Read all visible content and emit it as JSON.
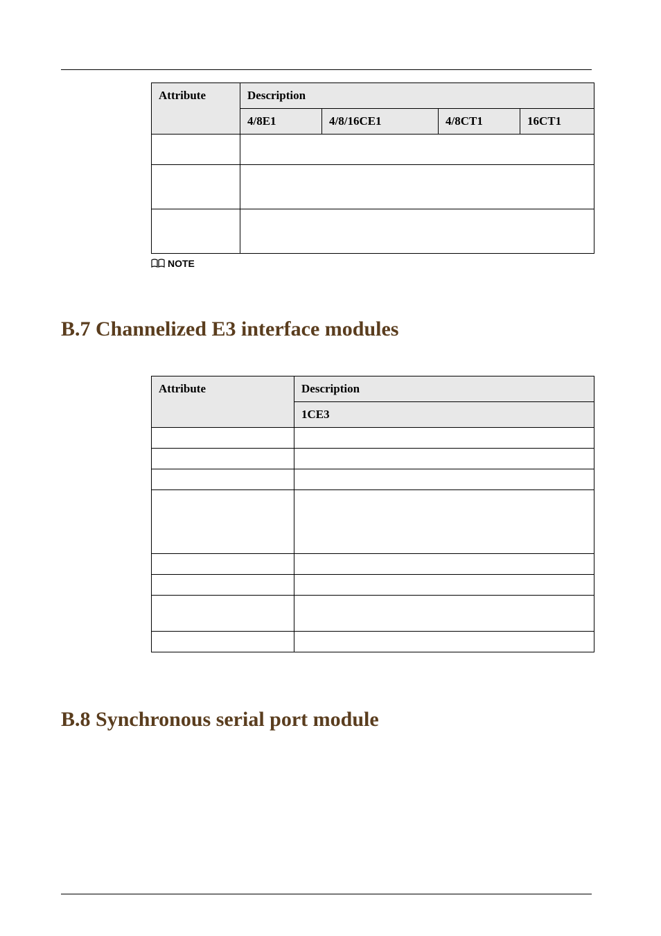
{
  "table1": {
    "header_attribute": "Attribute",
    "header_description": "Description",
    "sub": {
      "c1": "4/8E1",
      "c2": "4/8/16CE1",
      "c3": "4/8CT1",
      "c4": "16CT1"
    }
  },
  "note_label": "NOTE",
  "section_b7": "B.7 Channelized E3 interface modules",
  "table2": {
    "header_attribute": "Attribute",
    "header_description": "Description",
    "sub_c1": "1CE3"
  },
  "section_b8": "B.8 Synchronous serial port module"
}
